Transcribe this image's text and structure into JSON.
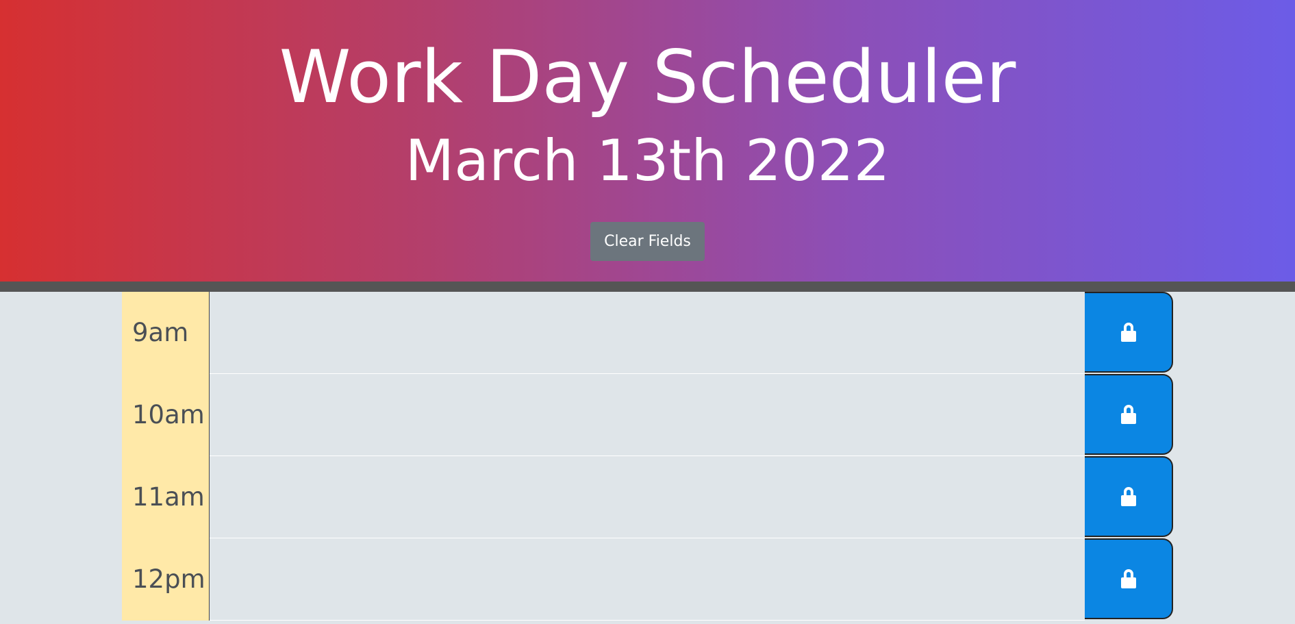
{
  "header": {
    "title": "Work Day Scheduler",
    "date": "March 13th 2022",
    "clear_label": "Clear Fields"
  },
  "colors": {
    "gradient_start": "#d63031",
    "gradient_end": "#6c5ce7",
    "hour_bg": "#ffe9a8",
    "save_bg": "#0b86e3",
    "row_bg": "#dfe5e9"
  },
  "hours": [
    {
      "label": "9am",
      "task": "",
      "save_icon": "lock-icon"
    },
    {
      "label": "10am",
      "task": "",
      "save_icon": "lock-icon"
    },
    {
      "label": "11am",
      "task": "",
      "save_icon": "lock-icon"
    },
    {
      "label": "12pm",
      "task": "",
      "save_icon": "lock-icon"
    }
  ]
}
